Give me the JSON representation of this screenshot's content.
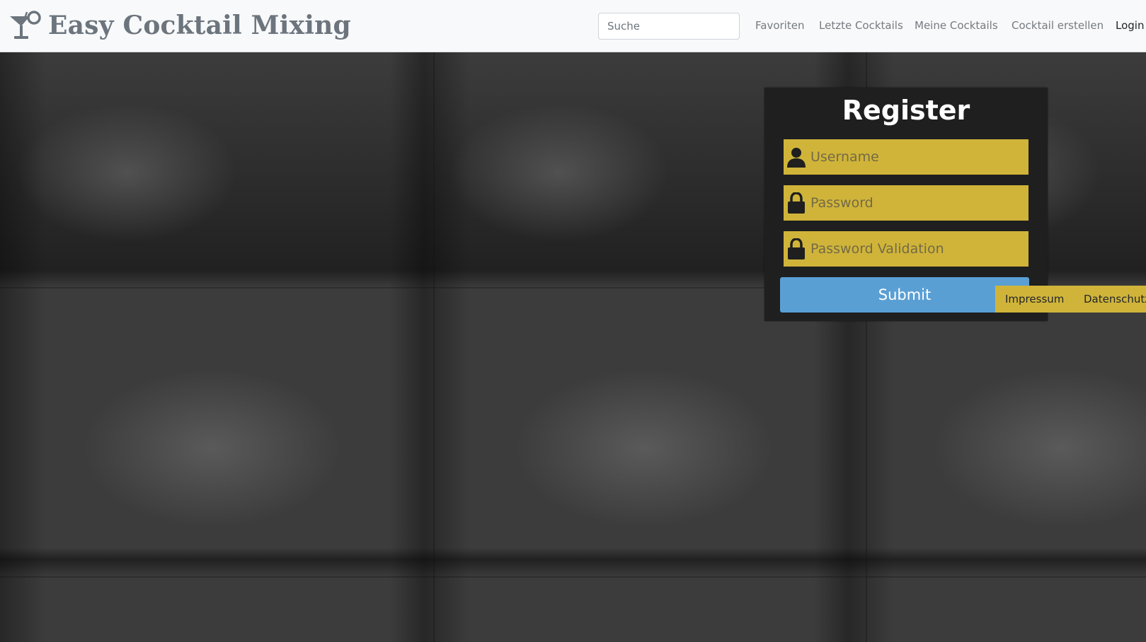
{
  "brand": {
    "title": "Easy Cocktail Mixing",
    "icon": "cocktail-glass-icon"
  },
  "search": {
    "placeholder": "Suche",
    "value": ""
  },
  "nav": {
    "items": [
      {
        "label": "Favoriten"
      },
      {
        "label": "Letzte Cocktails"
      },
      {
        "label": "Meine Cocktails"
      },
      {
        "label": "Cocktail erstellen"
      },
      {
        "label": "Login"
      }
    ]
  },
  "register": {
    "title": "Register",
    "username_placeholder": "Username",
    "password_placeholder": "Password",
    "password_validation_placeholder": "Password Validation",
    "submit_label": "Submit",
    "icons": {
      "user": "user-icon",
      "lock": "lock-icon"
    }
  },
  "footer": {
    "impressum": "Impressum",
    "datenschutz": "Datenschutz"
  },
  "colors": {
    "navbar_bg": "#f8f9fa",
    "field_bg": "#d0b43a",
    "submit_bg": "#5a9fd4",
    "panel_bg": "#1f1f1f",
    "brand_text": "#6c757d"
  }
}
